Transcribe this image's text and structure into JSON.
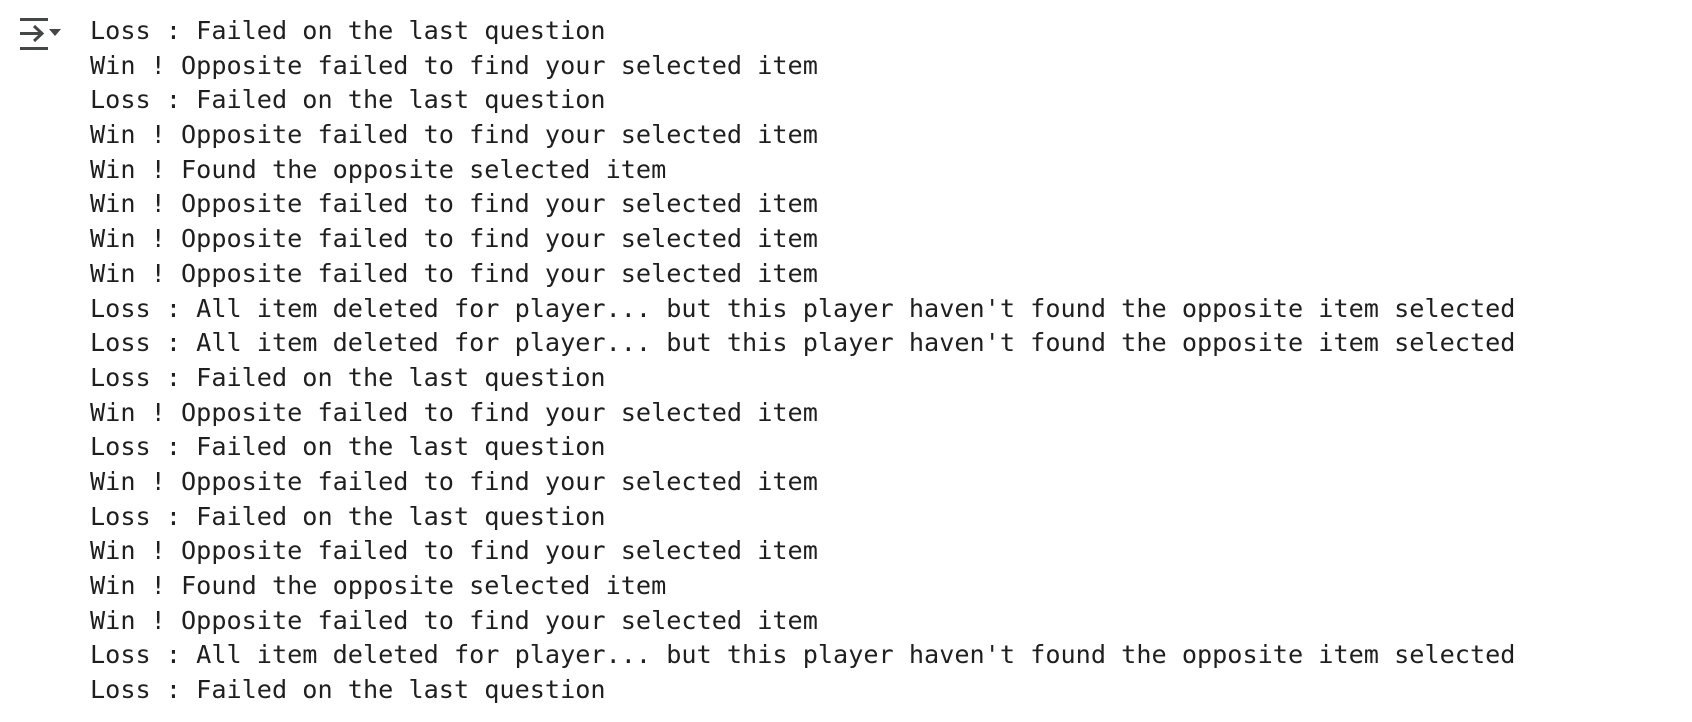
{
  "output": {
    "toggle_icon": "collapse-output-icon",
    "lines": [
      "Loss : Failed on the last question",
      "Win ! Opposite failed to find your selected item",
      "Loss : Failed on the last question",
      "Win ! Opposite failed to find your selected item",
      "Win ! Found the opposite selected item",
      "Win ! Opposite failed to find your selected item",
      "Win ! Opposite failed to find your selected item",
      "Win ! Opposite failed to find your selected item",
      "Loss : All item deleted for player... but this player haven't found the opposite item selected",
      "Loss : All item deleted for player... but this player haven't found the opposite item selected",
      "Loss : Failed on the last question",
      "Win ! Opposite failed to find your selected item",
      "Loss : Failed on the last question",
      "Win ! Opposite failed to find your selected item",
      "Loss : Failed on the last question",
      "Win ! Opposite failed to find your selected item",
      "Win ! Found the opposite selected item",
      "Win ! Opposite failed to find your selected item",
      "Loss : All item deleted for player... but this player haven't found the opposite item selected",
      "Loss : Failed on the last question"
    ]
  }
}
